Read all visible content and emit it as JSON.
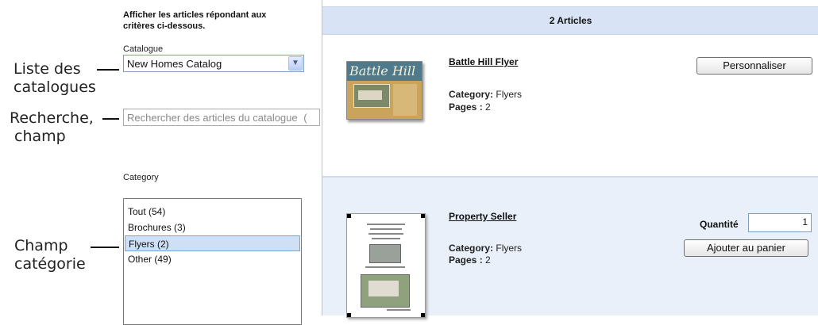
{
  "callouts": {
    "catalog_list": [
      "Liste des",
      "catalogues"
    ],
    "search_field": [
      "Recherche,",
      "champ"
    ],
    "category_field": [
      "Champ",
      "catégorie"
    ]
  },
  "filter": {
    "instructions_line1": "Afficher les articles répondant aux",
    "instructions_line2": "critères ci-dessous.",
    "catalog_label": "Catalogue",
    "catalog_value": "New Homes Catalog",
    "search_placeholder": "Rechercher des articles du catalogue",
    "search_trailing_char": "(",
    "category_label": "Category",
    "categories": [
      {
        "label": "Tout (54)",
        "selected": false
      },
      {
        "label": "Brochures (3)",
        "selected": false
      },
      {
        "label": "Flyers (2)",
        "selected": true
      },
      {
        "label": "Other (49)",
        "selected": false
      }
    ]
  },
  "results": {
    "header": "2 Articles",
    "items": [
      {
        "title": "Battle Hill Flyer",
        "category_label": "Category:",
        "category_value": "Flyers",
        "pages_label": "Pages :",
        "pages_value": "2",
        "thumbnail_text": "Battle Hill",
        "action_label": "Personnaliser"
      },
      {
        "title": "Property Seller",
        "category_label": "Category:",
        "category_value": "Flyers",
        "pages_label": "Pages :",
        "pages_value": "2",
        "quantity_label": "Quantité",
        "quantity_value": "1",
        "action_label": "Ajouter au panier"
      }
    ]
  },
  "colors": {
    "header_bg": "#d8e4f5",
    "row_alt_bg": "#e9f0fa",
    "selected_bg": "#cfe0f4"
  }
}
